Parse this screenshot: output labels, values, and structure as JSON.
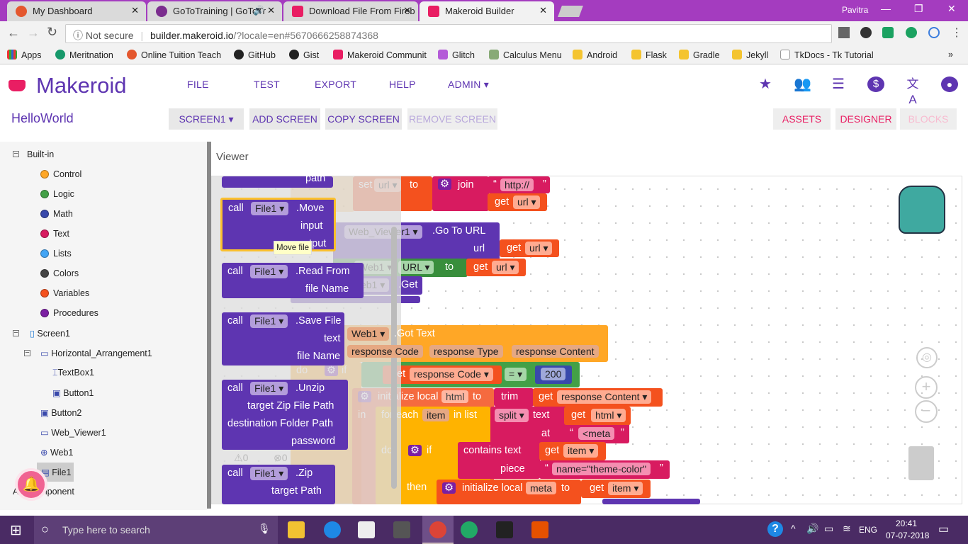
{
  "browser": {
    "tabs": [
      {
        "title": "My Dashboard"
      },
      {
        "title": "GoToTraining | GoToTr"
      },
      {
        "title": "Download File From Fireb"
      },
      {
        "title": "Makeroid Builder"
      }
    ],
    "profile": "Pavitra",
    "url_security": "Not secure",
    "url_host": "builder.makeroid.io",
    "url_rest": "/?locale=en#5670666258874368",
    "bookmarks": [
      "Apps",
      "Meritnation",
      "Online Tuition Teach",
      "GitHub",
      "Gist",
      "Makeroid Communit",
      "Glitch",
      "Calculus Menu",
      "Android",
      "Flask",
      "Gradle",
      "Jekyll",
      "TkDocs - Tk Tutorial"
    ],
    "more": "»"
  },
  "app": {
    "logo": "Makeroid",
    "menu": [
      "FILE",
      "TEST",
      "EXPORT",
      "HELP",
      "ADMIN ▾"
    ],
    "project": "HelloWorld",
    "screen_select": "SCREEN1 ▾",
    "add_screen": "ADD SCREEN",
    "copy_screen": "COPY SCREEN",
    "remove_screen": "REMOVE SCREEN",
    "assets": "ASSETS",
    "designer": "DESIGNER",
    "blocks": "BLOCKS",
    "viewer": "Viewer",
    "accent": "#5e35b1",
    "pink": "#e91e63"
  },
  "tree": {
    "builtin": "Built-in",
    "builtins": [
      "Control",
      "Logic",
      "Math",
      "Text",
      "Lists",
      "Colors",
      "Variables",
      "Procedures"
    ],
    "screen": "Screen1",
    "components": [
      "Horizontal_Arrangement1",
      "TextBox1",
      "Button1",
      "Button2",
      "Web_Viewer1",
      "Web1",
      "File1"
    ],
    "any": "Any component"
  },
  "blocks": {
    "call": "call",
    "file1": "File1 ▾",
    "path": "path",
    "move": ".Move",
    "input": "input",
    "output": "output",
    "tooltip": "Move file",
    "read": ".Read From",
    "fileName": "file Name",
    "save": ".Save File",
    "text": "text",
    "unzip": ".Unzip",
    "targetZip": "target Zip File Path",
    "destFolder": "destination Folder Path",
    "password": "password",
    "zip": ".Zip",
    "targetPath": "target Path",
    "warnings": "0",
    "errors": "0",
    "set": "set",
    "url": "url ▾",
    "to": "to",
    "join": "join",
    "http": "http://",
    "get": "get",
    "webviewer": "Web_Viewer1 ▾",
    "gotourl": ".Go To URL",
    "urlLabel": "url",
    "web1": "Web1 ▾",
    "URL": "URL ▾",
    "dotGet": ".Get",
    "gotText": ".Got Text",
    "responseCode": "response Code",
    "responseType": "response Type",
    "responseContent": "response Content",
    "do": "do",
    "if": "if",
    "getRespCode": "response Code ▾",
    "eq": "= ▾",
    "n200": "200",
    "initLocal": "initialize local",
    "html": "html",
    "trim": "trim",
    "getRespContent": "response Content ▾",
    "in": "in",
    "foreach": "for each",
    "item": "item",
    "inlist": "in list",
    "split": "split ▾",
    "getHtml": "html ▾",
    "at": "at",
    "meta": "<meta",
    "contains": "contains  text",
    "getItem": "item ▾",
    "piece": "piece",
    "themeColor": "name=\"theme-color\"",
    "then": "then",
    "metaVar": "meta"
  },
  "taskbar": {
    "search": "Type here to search",
    "lang": "ENG",
    "time": "20:41",
    "date": "07-07-2018"
  }
}
